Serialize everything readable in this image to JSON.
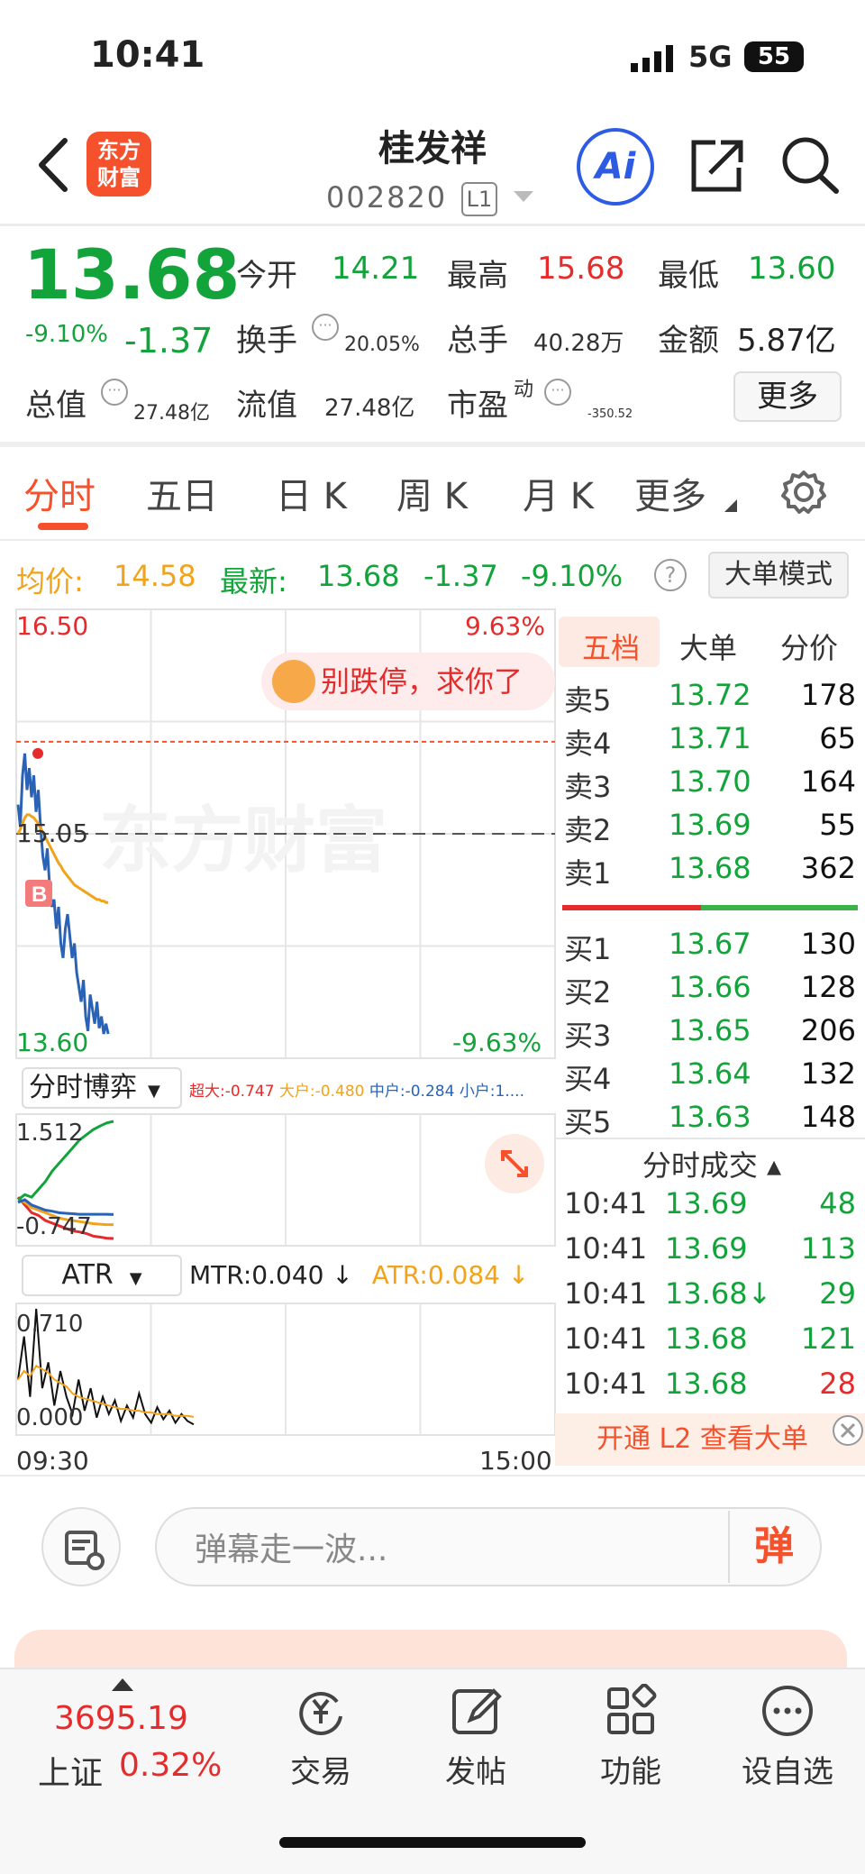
{
  "status_bar": {
    "time": "10:41",
    "network": "5G",
    "battery": "55"
  },
  "header": {
    "logo_line1": "东方",
    "logo_line2": "财富",
    "name": "桂发祥",
    "code": "002820",
    "level_badge": "L1",
    "ai_label": "Ai"
  },
  "quote": {
    "last_price": "13.68",
    "change_pct": "-9.10%",
    "change_value": "-1.37",
    "open_label": "今开",
    "open": "14.21",
    "high_label": "最高",
    "high": "15.68",
    "low_label": "最低",
    "low": "13.60",
    "turnover_label": "换手",
    "turnover": "20.05%",
    "volume_label": "总手",
    "volume": "40.28万",
    "amount_label": "金额",
    "amount": "5.87亿",
    "mktcap_label": "总值",
    "mktcap": "27.48亿",
    "float_label": "流值",
    "float_cap": "27.48亿",
    "pe_label": "市盈",
    "pe_sup": "动",
    "pe": "-350.52",
    "more_button": "更多"
  },
  "tabs": [
    "分时",
    "五日",
    "日 K",
    "周 K",
    "月 K",
    "更多"
  ],
  "info_line": {
    "avg_label": "均价:",
    "avg": "14.58",
    "latest_label": "最新:",
    "latest": "13.68",
    "latest_change": "-1.37",
    "latest_pct": "-9.10%",
    "big_order_mode": "大单模式"
  },
  "chart_data": [
    {
      "type": "line",
      "title": "分时",
      "y_left_max": "16.50",
      "y_left_min": "13.60",
      "y_mid": "15.05",
      "y_right_max": "9.63%",
      "y_right_min": "-9.63%",
      "ylim": [
        13.6,
        16.5
      ],
      "prev_close": 15.05,
      "x_start": "09:30",
      "x_end": "15:00",
      "series": [
        {
          "name": "price",
          "color": "#2a63b6",
          "values": [
            15.25,
            15.1,
            15.45,
            15.6,
            15.35,
            15.5,
            15.3,
            15.45,
            15.2,
            15.35,
            15.1,
            14.9,
            14.8,
            14.95,
            14.7,
            14.55,
            14.6,
            14.4,
            14.55,
            14.3,
            14.2,
            14.4,
            14.5,
            14.35,
            14.2,
            14.3,
            14.1,
            14.0,
            13.9,
            14.05,
            13.8,
            13.7,
            13.95,
            13.85,
            13.75,
            13.9,
            13.72,
            13.8,
            13.68,
            13.75,
            13.68
          ]
        },
        {
          "name": "avg",
          "color": "#f2a31c",
          "values": [
            15.05,
            15.08,
            15.12,
            15.16,
            15.18,
            15.18,
            15.17,
            15.16,
            15.14,
            15.12,
            15.09,
            15.06,
            15.03,
            15.0,
            14.97,
            14.94,
            14.91,
            14.88,
            14.85,
            14.83,
            14.8,
            14.78,
            14.76,
            14.74,
            14.72,
            14.7,
            14.69,
            14.68,
            14.67,
            14.66,
            14.65,
            14.64,
            14.63,
            14.62,
            14.61,
            14.6,
            14.6,
            14.59,
            14.59,
            14.58,
            14.58
          ]
        }
      ],
      "buy_marker": "B"
    },
    {
      "type": "line",
      "title": "分时博弈",
      "y_max": "1.512",
      "y_min": "-0.747",
      "ylim": [
        -0.747,
        1.512
      ],
      "series": [
        {
          "name": "超大",
          "color": "#e52b2b",
          "values": [
            0.05,
            -0.1,
            -0.25,
            -0.3,
            -0.4,
            -0.45,
            -0.5,
            -0.55,
            -0.6,
            -0.62,
            -0.65,
            -0.7,
            -0.72,
            -0.74,
            -0.747
          ]
        },
        {
          "name": "大户",
          "color": "#f2a31c",
          "values": [
            0.0,
            -0.05,
            -0.15,
            -0.2,
            -0.25,
            -0.3,
            -0.35,
            -0.38,
            -0.4,
            -0.42,
            -0.44,
            -0.46,
            -0.47,
            -0.48,
            -0.48
          ]
        },
        {
          "name": "中户",
          "color": "#2a63b6",
          "values": [
            -0.05,
            0.0,
            -0.1,
            -0.15,
            -0.2,
            -0.22,
            -0.25,
            -0.26,
            -0.27,
            -0.28,
            -0.28,
            -0.28,
            -0.28,
            -0.28,
            -0.284
          ]
        },
        {
          "name": "小户",
          "color": "#13a33b",
          "values": [
            0.0,
            0.1,
            0.05,
            0.2,
            0.35,
            0.55,
            0.7,
            0.85,
            1.0,
            1.15,
            1.25,
            1.35,
            1.42,
            1.48,
            1.512
          ]
        }
      ],
      "labels": {
        "chaoda": "超大:-0.747",
        "dahu": "大户:-0.480",
        "zhonghu": "中户:-0.284",
        "xiaohu": "小户:1...."
      }
    },
    {
      "type": "line",
      "title": "ATR",
      "y_max": "0.710",
      "y_min": "0.000",
      "ylim": [
        0,
        0.71
      ],
      "mtr_label": "MTR:0.040 ↓",
      "atr_label": "ATR:0.084 ↓",
      "series": [
        {
          "name": "MTR",
          "color": "#111111",
          "values": [
            0.3,
            0.55,
            0.2,
            0.71,
            0.25,
            0.4,
            0.15,
            0.35,
            0.2,
            0.1,
            0.3,
            0.12,
            0.25,
            0.08,
            0.2,
            0.1,
            0.18,
            0.06,
            0.15,
            0.08,
            0.22,
            0.1,
            0.05,
            0.14,
            0.07,
            0.12,
            0.05,
            0.1,
            0.06,
            0.04
          ]
        },
        {
          "name": "ATR",
          "color": "#f2a31c",
          "values": [
            0.3,
            0.35,
            0.32,
            0.38,
            0.36,
            0.34,
            0.3,
            0.28,
            0.26,
            0.22,
            0.2,
            0.19,
            0.18,
            0.17,
            0.16,
            0.15,
            0.14,
            0.13,
            0.13,
            0.12,
            0.12,
            0.11,
            0.11,
            0.1,
            0.1,
            0.1,
            0.09,
            0.09,
            0.09,
            0.084
          ]
        }
      ]
    }
  ],
  "chart_overlay": {
    "bubble_text": "别跌停，求你了",
    "indicator_dropdown": "分时博弈",
    "atr_dropdown": "ATR"
  },
  "order_book": {
    "tabs": [
      "五档",
      "大单",
      "分价"
    ],
    "asks": [
      {
        "label": "卖5",
        "price": "13.72",
        "volume": "178"
      },
      {
        "label": "卖4",
        "price": "13.71",
        "volume": "65"
      },
      {
        "label": "卖3",
        "price": "13.70",
        "volume": "164"
      },
      {
        "label": "卖2",
        "price": "13.69",
        "volume": "55"
      },
      {
        "label": "卖1",
        "price": "13.68",
        "volume": "362"
      }
    ],
    "bids": [
      {
        "label": "买1",
        "price": "13.67",
        "volume": "130"
      },
      {
        "label": "买2",
        "price": "13.66",
        "volume": "128"
      },
      {
        "label": "买3",
        "price": "13.65",
        "volume": "206"
      },
      {
        "label": "买4",
        "price": "13.64",
        "volume": "132"
      },
      {
        "label": "买5",
        "price": "13.63",
        "volume": "148"
      }
    ],
    "ratio_sell_fraction": 0.47
  },
  "ticks": {
    "header": "分时成交 ▴",
    "rows": [
      {
        "time": "10:41",
        "price": "13.69",
        "volume": "48",
        "color": "#13a33b"
      },
      {
        "time": "10:41",
        "price": "13.69",
        "volume": "113",
        "color": "#13a33b"
      },
      {
        "time": "10:41",
        "price": "13.68↓",
        "volume": "29",
        "color": "#13a33b"
      },
      {
        "time": "10:41",
        "price": "13.68",
        "volume": "121",
        "color": "#13a33b"
      },
      {
        "time": "10:41",
        "price": "13.68",
        "volume": "28",
        "color": "#e52b2b"
      }
    ],
    "l2_banner": "开通 L2 查看大单"
  },
  "danmaku": {
    "placeholder": "弹幕走一波...",
    "send": "弹"
  },
  "bottom_nav": {
    "index_value": "3695.19",
    "index_name": "上证",
    "index_pct": "0.32%",
    "items": [
      {
        "label": "交易",
        "icon": "trade-icon"
      },
      {
        "label": "发帖",
        "icon": "post-icon"
      },
      {
        "label": "功能",
        "icon": "apps-icon"
      },
      {
        "label": "设自选",
        "icon": "more-icon"
      }
    ]
  },
  "colors": {
    "up": "#e52b2b",
    "down": "#13a33b",
    "accent": "#f4512c",
    "avg": "#f2a31c",
    "price_line": "#2a63b6"
  }
}
